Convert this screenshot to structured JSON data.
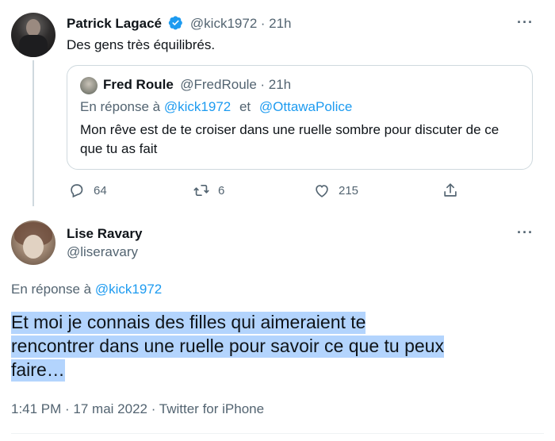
{
  "tweet": {
    "author_name": "Patrick Lagacé",
    "handle": "@kick1972",
    "time": "21h",
    "text": "Des gens très équilibrés.",
    "verified_color": "#1d9bf0",
    "quote": {
      "author_name": "Fred Roule",
      "handle": "@FredRoule",
      "time": "21h",
      "reply_prefix": "En réponse à",
      "reply_to_1": "@kick1972",
      "reply_joiner": "et",
      "reply_to_2": "@OttawaPolice",
      "text_line1": "Mon rêve est de te croiser dans une ruelle sombre pour discuter de ce",
      "text_line2": "que tu as fait"
    },
    "actions": {
      "replies": "64",
      "retweets": "6",
      "likes": "215"
    }
  },
  "reply": {
    "author_name": "Lise Ravary",
    "handle": "@liseravary",
    "reply_prefix": "En réponse à",
    "reply_to": "@kick1972",
    "text_line1": "Et moi je connais des filles qui aimeraient te",
    "text_line2": "rencontrer dans une ruelle pour savoir ce que tu peux",
    "text_line3": "faire…",
    "meta": "1:41 PM · 17 mai 2022 · Twitter for iPhone"
  },
  "colors": {
    "accent": "#1d9bf0",
    "muted": "#536471",
    "highlight": "#b3d4fd"
  }
}
